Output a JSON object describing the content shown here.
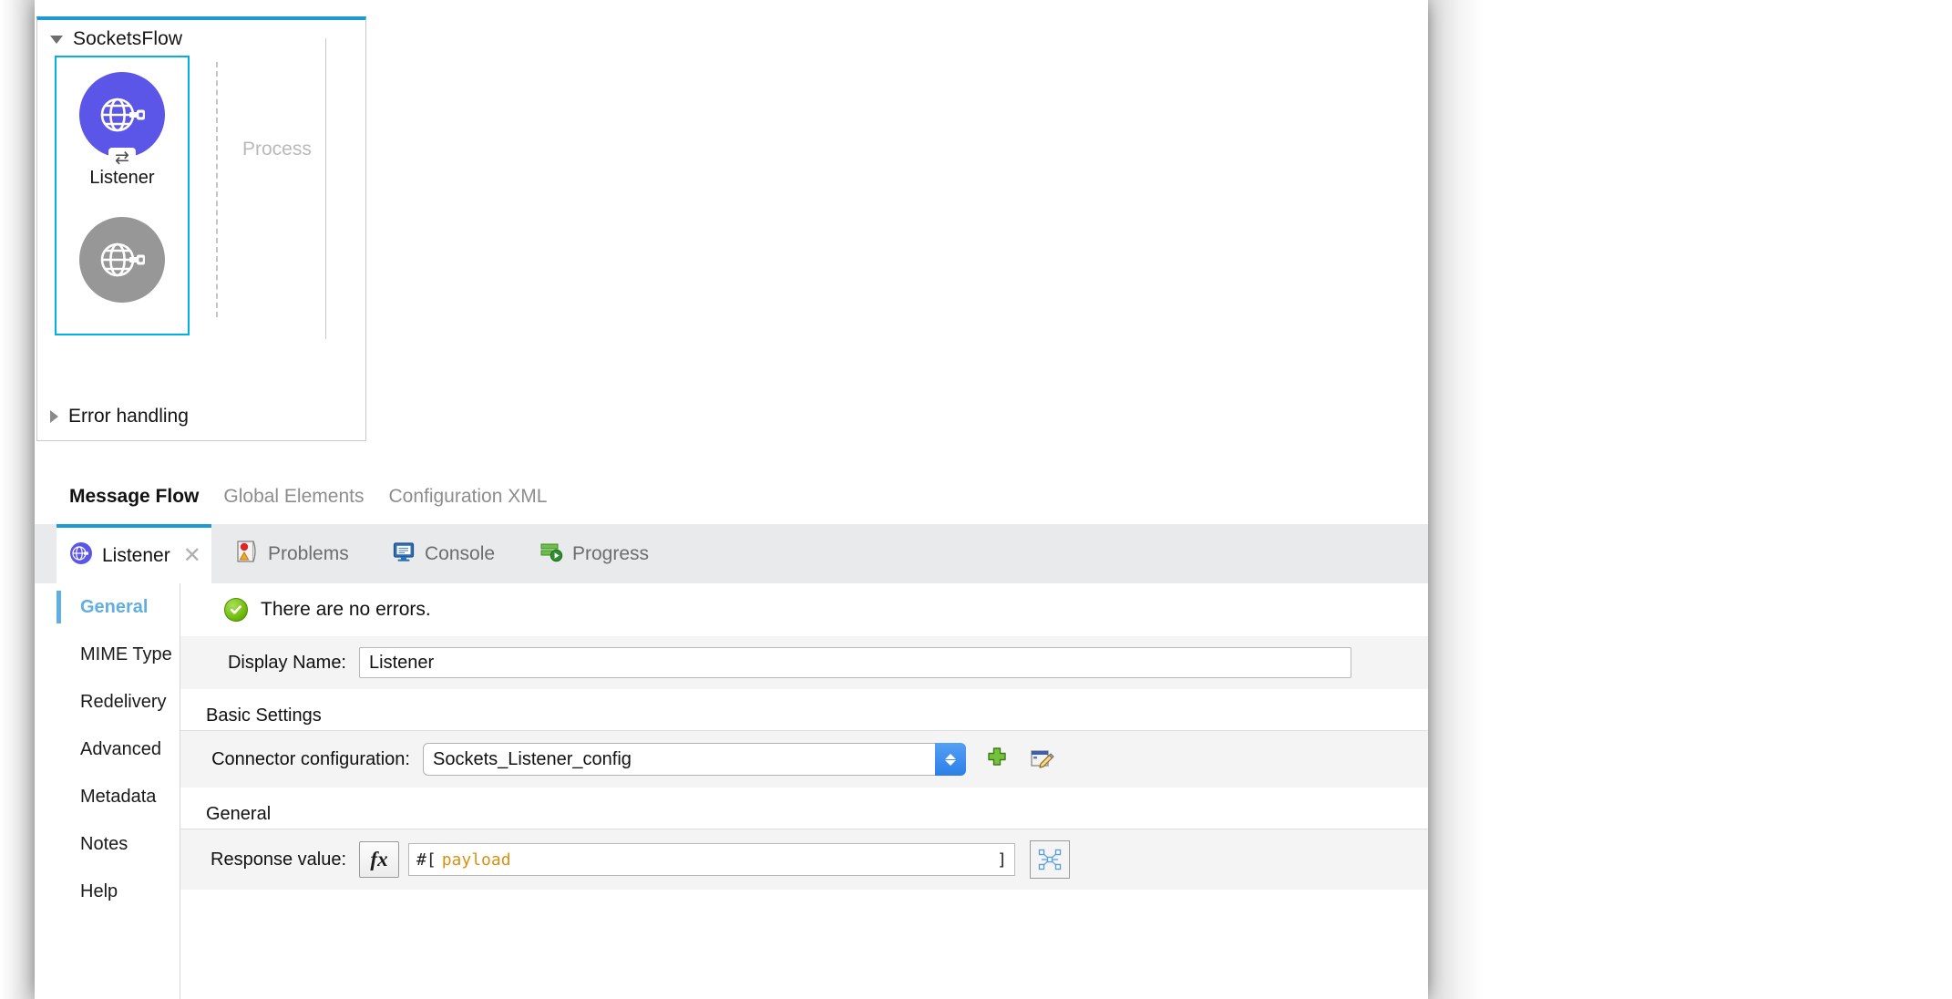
{
  "canvas": {
    "flow": {
      "name": "SocketsFlow",
      "expanded_icon": "triangle-down-icon",
      "source": {
        "node_label": "Listener",
        "node_icon": "globe-socket-icon",
        "badge_icon": "exchange-arrows-icon",
        "ghost_node_icon": "globe-socket-icon",
        "primary_color": "#5b56e8",
        "ghost_color": "#979797",
        "selection_color": "#00b0e0"
      },
      "process_placeholder": "Process",
      "error_handling_label": "Error handling",
      "error_handling_icon": "triangle-right-icon"
    }
  },
  "editor_tabs": [
    {
      "label": "Message Flow",
      "active": true
    },
    {
      "label": "Global Elements",
      "active": false
    },
    {
      "label": "Configuration XML",
      "active": false
    }
  ],
  "panel_tabs": [
    {
      "label": "Listener",
      "icon": "globe-socket-icon",
      "active": true,
      "close_icon": "close-icon",
      "close_glyph": "✕"
    },
    {
      "label": "Problems",
      "icon": "problems-icon",
      "active": false
    },
    {
      "label": "Console",
      "icon": "console-icon",
      "active": false
    },
    {
      "label": "Progress",
      "icon": "progress-icon",
      "active": false
    }
  ],
  "properties": {
    "nav": [
      {
        "label": "General",
        "active": true
      },
      {
        "label": "MIME Type",
        "active": false
      },
      {
        "label": "Redelivery",
        "active": false
      },
      {
        "label": "Advanced",
        "active": false
      },
      {
        "label": "Metadata",
        "active": false
      },
      {
        "label": "Notes",
        "active": false
      },
      {
        "label": "Help",
        "active": false
      }
    ],
    "status": {
      "icon": "success-check-icon",
      "text": "There are no errors."
    },
    "display_name": {
      "label": "Display Name:",
      "value": "Listener"
    },
    "basic_settings": {
      "header": "Basic Settings",
      "connector_configuration": {
        "label": "Connector configuration:",
        "value": "Sockets_Listener_config",
        "stepper_icon": "chevron-updown-icon",
        "add_icon": "plus-icon",
        "edit_icon": "edit-pencil-icon"
      }
    },
    "general": {
      "header": "General",
      "response_value": {
        "label": "Response value:",
        "fx_label": "fx",
        "expression_open": "#[",
        "expression_token": "payload",
        "expression_close": "]",
        "transform_icon": "dataweave-transform-icon"
      }
    }
  },
  "colors": {
    "accent_blue": "#1d9ad6",
    "selection_cyan": "#00b0e0",
    "nav_active": "#61afe0",
    "expression_orange": "#d89013",
    "node_purple": "#5b56e8"
  }
}
